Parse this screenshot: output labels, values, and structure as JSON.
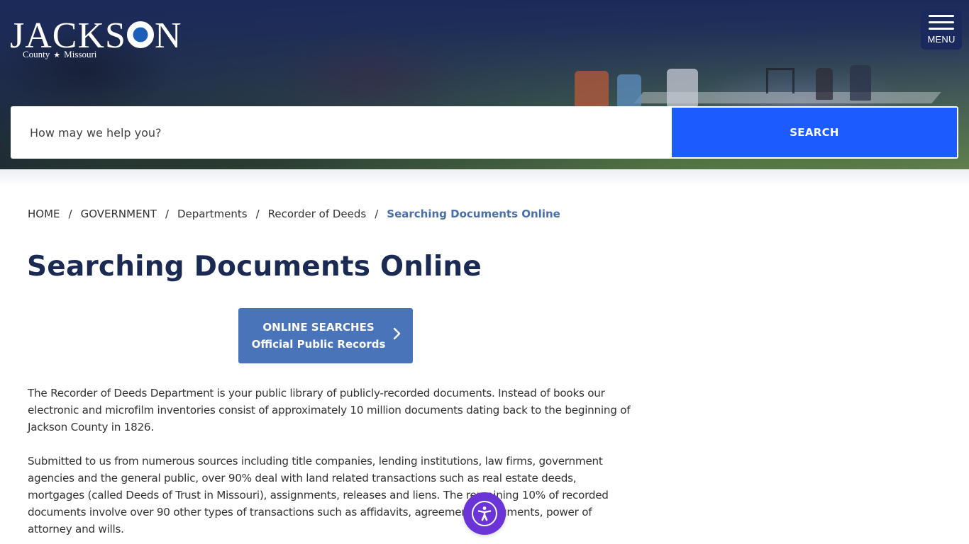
{
  "header": {
    "logo": {
      "word_left": "JACKS",
      "word_right": "N",
      "county": "County",
      "star": "★",
      "state": "Missouri"
    },
    "menu_label": "MENU"
  },
  "search": {
    "placeholder": "How may we help you?",
    "value": "",
    "button_label": "SEARCH"
  },
  "breadcrumb": {
    "items": [
      "HOME",
      "GOVERNMENT",
      "Departments",
      "Recorder of Deeds"
    ],
    "current": "Searching Documents Online",
    "separator": "/"
  },
  "page": {
    "title": "Searching Documents Online",
    "cta": {
      "line1": "ONLINE SEARCHES",
      "line2": "Official Public Records",
      "icon": "chevron-right"
    },
    "paragraphs": [
      "The Recorder of Deeds Department is your public library of publicly-recorded documents. Instead of books our electronic and microfilm inventories consist of approximately 10 million documents dating back to the beginning of Jackson County in 1826.",
      "Submitted to us from numerous sources including title companies, lending institutions, law firms, government agencies and the general public, over 90% deal with land related transactions such as real estate deeds, mortgages (called Deeds of Trust in Missouri), assignments, releases and liens. The remaining 10% of recorded documents involve over 90 other types of transactions such as affidavits, agreements, judgments, power of attorney and wills."
    ]
  },
  "accessibility": {
    "icon": "accessibility-person"
  },
  "colors": {
    "navy": "#1b2a52",
    "search_button": "#1c5cff",
    "cta": "#4a74b9",
    "breadcrumb_current": "#4a6ea8",
    "accessibility": "#6b34d6"
  }
}
